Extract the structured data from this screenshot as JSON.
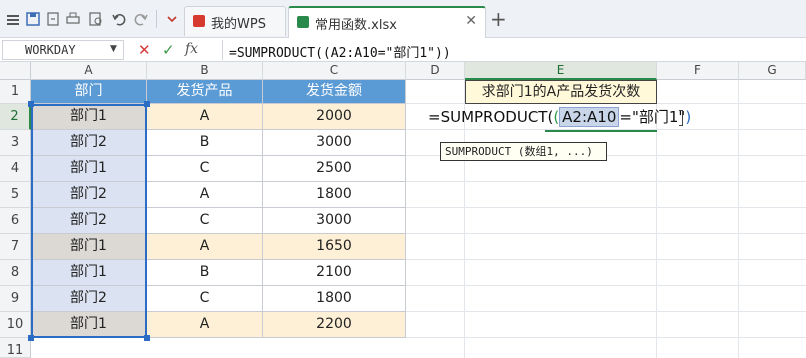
{
  "tabs": [
    {
      "label": "我的WPS",
      "icon": "wps-icon"
    },
    {
      "label": "常用函数.xlsx",
      "icon": "xlsx-file-icon"
    }
  ],
  "formula_bar": {
    "name_box": "WORKDAY",
    "cancel_label": "✕",
    "ok_label": "✓",
    "fx_label": "fx",
    "formula": "=SUMPRODUCT((A2:A10=\"部门1\"))"
  },
  "columns": [
    "A",
    "B",
    "C",
    "D",
    "E",
    "F",
    "G"
  ],
  "rows": [
    "1",
    "2",
    "3",
    "4",
    "5",
    "6",
    "7",
    "8",
    "9",
    "10",
    "11"
  ],
  "table": {
    "headers": [
      "部门",
      "发货产品",
      "发货金额"
    ],
    "rows": [
      [
        "部门1",
        "A",
        "2000"
      ],
      [
        "部门2",
        "B",
        "3000"
      ],
      [
        "部门1",
        "C",
        "2500"
      ],
      [
        "部门2",
        "A",
        "1800"
      ],
      [
        "部门2",
        "C",
        "3000"
      ],
      [
        "部门1",
        "A",
        "1650"
      ],
      [
        "部门1",
        "B",
        "2100"
      ],
      [
        "部门2",
        "C",
        "1800"
      ],
      [
        "部门1",
        "A",
        "2200"
      ]
    ]
  },
  "e1_label": "求部门1的A产品发货次数",
  "cell_edit": {
    "prefix": "=SUMPRODUCT(",
    "paren1": "(",
    "ref": "A2:A10",
    "rest": "=\"部门1\"",
    "close": ")"
  },
  "tooltip": "SUMPRODUCT (数组1, ...)",
  "colors": {
    "header_blue": "#5b9bd5",
    "accent_green": "#2a8a4b",
    "selection_blue": "#2b6cc4"
  }
}
